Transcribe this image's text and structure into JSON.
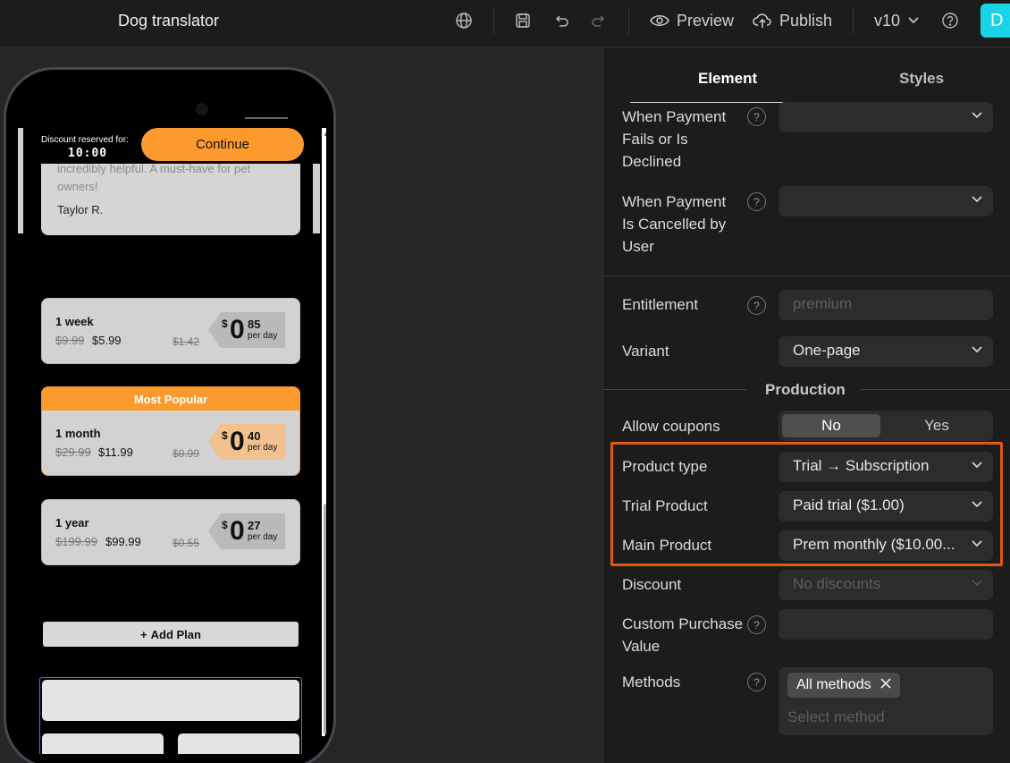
{
  "app": {
    "title": "Dog translator",
    "version": "v10",
    "user_initial": "D",
    "preview_label": "Preview",
    "publish_label": "Publish"
  },
  "colors": {
    "accent_orange": "#fd9a2e",
    "highlight_border": "#e05a10",
    "avatar_bg": "#19d3e6",
    "selection_blue": "#4b7cff"
  },
  "phone": {
    "discount_label": "Discount reserved for:",
    "timer": "10:00",
    "continue_label": "Continue",
    "review": {
      "text": "incredibly helpful. A must-have for pet owners!",
      "author": "Taylor R."
    },
    "popular_label": "Most Popular",
    "plans": [
      {
        "name": "1 week",
        "old_price": "$9.99",
        "new_price": "$5.99",
        "old_per_day": "$1.42",
        "currency": "$",
        "int": "0",
        "cents": "85",
        "per_day_label": "per day"
      },
      {
        "name": "1 month",
        "old_price": "$29.99",
        "new_price": "$11.99",
        "old_per_day": "$0.99",
        "currency": "$",
        "int": "0",
        "cents": "40",
        "per_day_label": "per day"
      },
      {
        "name": "1 year",
        "old_price": "$199.99",
        "new_price": "$99.99",
        "old_per_day": "$0.55",
        "currency": "$",
        "int": "0",
        "cents": "27",
        "per_day_label": "per day"
      }
    ],
    "add_plan_label": "Add Plan"
  },
  "panel": {
    "tabs": {
      "element": "Element",
      "styles": "Styles"
    },
    "payment_fails_label": "When Payment Fails or Is Declined",
    "payment_cancelled_label": "When Payment Is Cancelled by User",
    "entitlement_label": "Entitlement",
    "entitlement_placeholder": "premium",
    "variant_label": "Variant",
    "variant_value": "One-page",
    "production_title": "Production",
    "allow_coupons_label": "Allow coupons",
    "coupons_no": "No",
    "coupons_yes": "Yes",
    "product_type_label": "Product type",
    "product_type_value": "Trial → Subscription",
    "trial_product_label": "Trial Product",
    "trial_product_value": "Paid trial ($1.00)",
    "main_product_label": "Main Product",
    "main_product_value": "Prem monthly ($10.00...",
    "discount_label": "Discount",
    "discount_value": "No discounts",
    "custom_purchase_label": "Custom Purchase Value",
    "methods_label": "Methods",
    "methods_chip": "All methods",
    "methods_placeholder": "Select method",
    "help_glyph": "?"
  }
}
